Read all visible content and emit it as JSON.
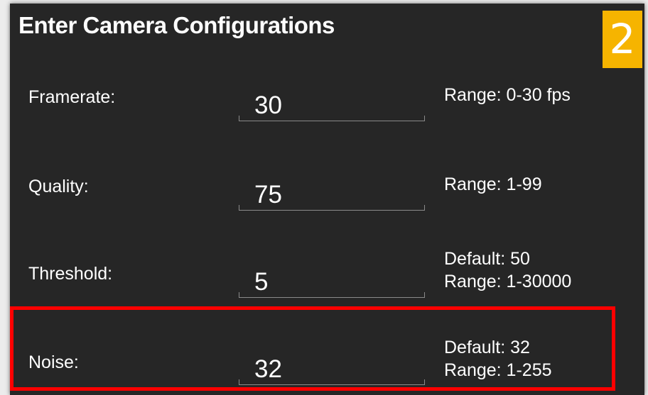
{
  "dialog": {
    "title": "Enter Camera Configurations",
    "step_number": "2",
    "badge_color": "#f6b400",
    "highlight_color": "#ff0000"
  },
  "fields": [
    {
      "label": "Framerate:",
      "value": "30",
      "hint_line1": "Range: 0-30 fps",
      "hint_line2": ""
    },
    {
      "label": "Quality:",
      "value": "75",
      "hint_line1": "Range: 1-99",
      "hint_line2": ""
    },
    {
      "label": "Threshold:",
      "value": "5",
      "hint_line1": "Default: 50",
      "hint_line2": "Range: 1-30000"
    },
    {
      "label": "Noise:",
      "value": "32",
      "hint_line1": "Default: 32",
      "hint_line2": "Range: 1-255"
    }
  ]
}
